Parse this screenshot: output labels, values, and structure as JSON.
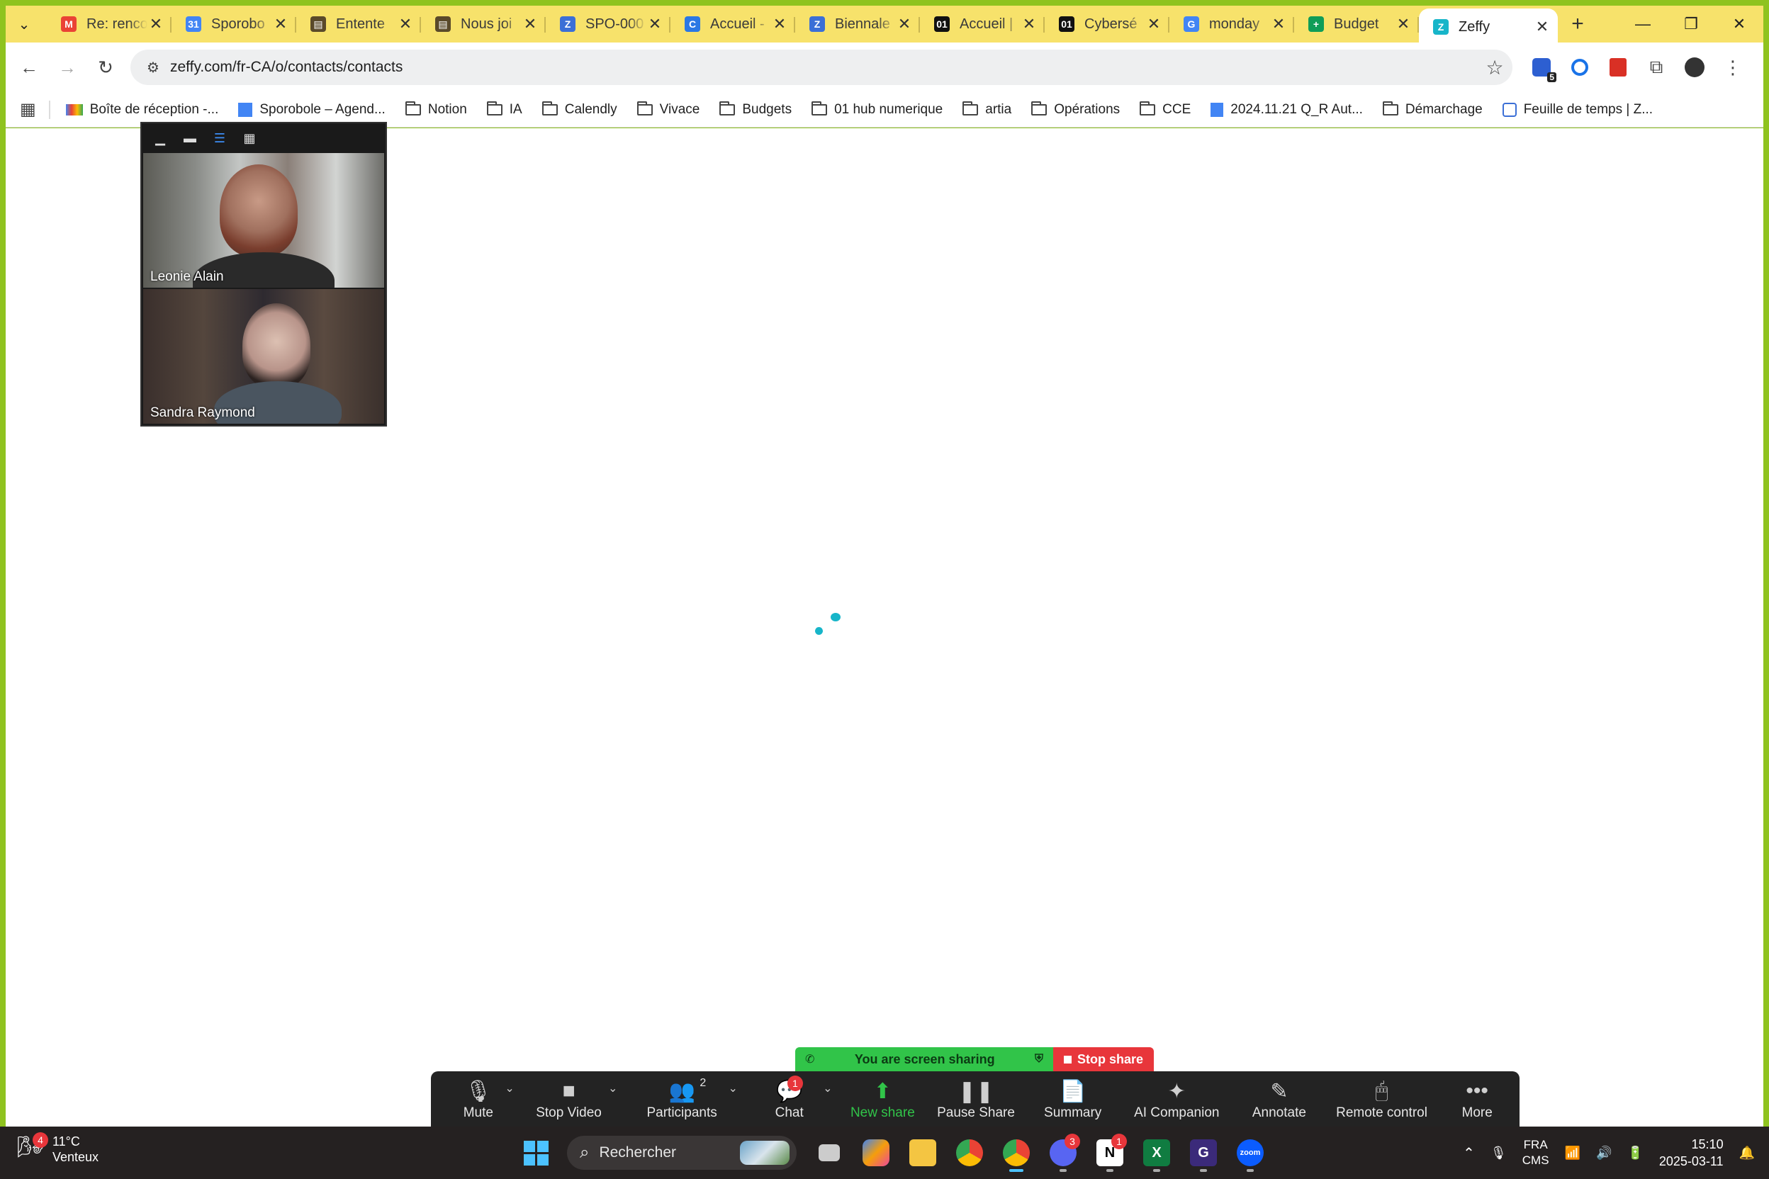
{
  "browser": {
    "tabs": [
      {
        "title": "Re: renco",
        "icon": "gmail-icon",
        "color": "#ea4335",
        "glyph": "M"
      },
      {
        "title": "Sporobo",
        "icon": "calendar-icon",
        "color": "#4285f4",
        "glyph": "31"
      },
      {
        "title": "Entente",
        "icon": "doc-icon",
        "color": "#5a4a2a",
        "glyph": "▤"
      },
      {
        "title": "Nous joi",
        "icon": "doc-icon",
        "color": "#5a4a2a",
        "glyph": "▤"
      },
      {
        "title": "SPO-000",
        "icon": "zeffy-icon",
        "color": "#3b6fd6",
        "glyph": "Z"
      },
      {
        "title": "Accueil -",
        "icon": "canva-icon",
        "color": "#2b78e4",
        "glyph": "C"
      },
      {
        "title": "Biennale",
        "icon": "zeffy-icon",
        "color": "#3b6fd6",
        "glyph": "Z"
      },
      {
        "title": "Accueil |",
        "icon": "hub01-icon",
        "color": "#111111",
        "glyph": "01"
      },
      {
        "title": "Cybersé",
        "icon": "hub01-icon",
        "color": "#111111",
        "glyph": "01"
      },
      {
        "title": "monday",
        "icon": "google-icon",
        "color": "#4285f4",
        "glyph": "G"
      },
      {
        "title": "Budget",
        "icon": "sheets-icon",
        "color": "#0f9d58",
        "glyph": "+"
      },
      {
        "title": "Zeffy",
        "icon": "zeffy-icon",
        "color": "#17b5c9",
        "glyph": "Z",
        "active": true
      }
    ],
    "url": "zeffy.com/fr-CA/o/contacts/contacts",
    "bookmarks": [
      {
        "label": "Boîte de réception -...",
        "type": "gmail"
      },
      {
        "label": "Sporobole – Agend...",
        "type": "calendar"
      },
      {
        "label": "Notion",
        "type": "folder"
      },
      {
        "label": "IA",
        "type": "folder"
      },
      {
        "label": "Calendly",
        "type": "folder"
      },
      {
        "label": "Vivace",
        "type": "folder"
      },
      {
        "label": "Budgets",
        "type": "folder"
      },
      {
        "label": "01 hub numerique",
        "type": "folder"
      },
      {
        "label": "artia",
        "type": "folder"
      },
      {
        "label": "Opérations",
        "type": "folder"
      },
      {
        "label": "CCE",
        "type": "folder"
      },
      {
        "label": "2024.11.21 Q_R Aut...",
        "type": "doc"
      },
      {
        "label": "Démarchage",
        "type": "folder"
      },
      {
        "label": "Feuille de temps | Z...",
        "type": "zeffy"
      }
    ],
    "extension_badge": "5"
  },
  "video": {
    "participants": [
      {
        "name": "Leonie Alain"
      },
      {
        "name": "Sandra Raymond"
      }
    ]
  },
  "share": {
    "status": "You are screen sharing",
    "stop_label": "Stop share"
  },
  "zoom_toolbar": {
    "mute": "Mute",
    "stop_video": "Stop Video",
    "participants": "Participants",
    "participants_count": "2",
    "chat": "Chat",
    "chat_badge": "1",
    "new_share": "New share",
    "pause_share": "Pause Share",
    "summary": "Summary",
    "ai_companion": "AI Companion",
    "annotate": "Annotate",
    "remote_control": "Remote control",
    "more": "More"
  },
  "taskbar": {
    "weather_temp": "11°C",
    "weather_desc": "Venteux",
    "weather_badge": "4",
    "search_placeholder": "Rechercher",
    "discord_badge": "3",
    "notion_badge": "1",
    "lang_top": "FRA",
    "lang_bottom": "CMS",
    "time": "15:10",
    "date": "2025-03-11"
  },
  "colors": {
    "share_border": "#8fc31f",
    "tabstrip": "#f7e26b",
    "zeffy_accent": "#17b5c9",
    "share_green": "#31c449",
    "stop_red": "#e8363b"
  }
}
